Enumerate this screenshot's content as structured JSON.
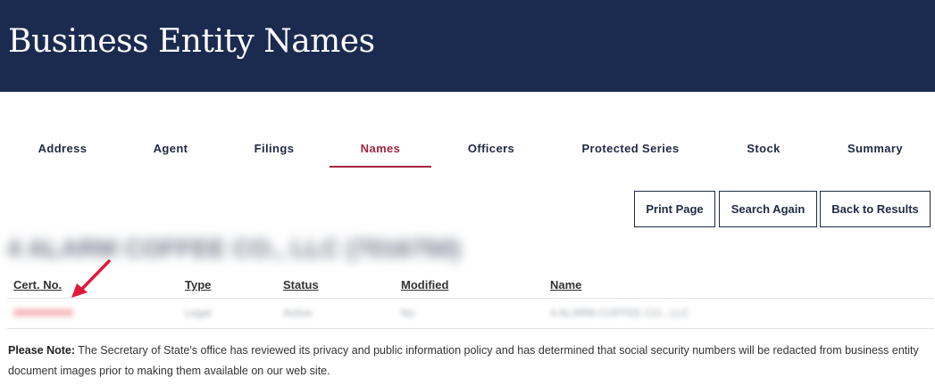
{
  "header": {
    "title": "Business Entity Names"
  },
  "tabs": [
    {
      "label": "Address",
      "active": false
    },
    {
      "label": "Agent",
      "active": false
    },
    {
      "label": "Filings",
      "active": false
    },
    {
      "label": "Names",
      "active": true
    },
    {
      "label": "Officers",
      "active": false
    },
    {
      "label": "Protected Series",
      "active": false
    },
    {
      "label": "Stock",
      "active": false
    },
    {
      "label": "Summary",
      "active": false
    }
  ],
  "actions": {
    "print_label": "Print Page",
    "search_again_label": "Search Again",
    "back_label": "Back to Results"
  },
  "entity": {
    "title": "4 ALARM COFFEE CO., LLC (7016750)"
  },
  "table": {
    "headers": [
      "Cert. No.",
      "Type",
      "Status",
      "Modified",
      "Name"
    ],
    "rows": [
      [
        "0000000000",
        "Legal",
        "Active",
        "No",
        "4 ALARM COFFEE CO., LLC"
      ]
    ]
  },
  "note": {
    "prefix": "Please Note:",
    "text": " The Secretary of State's office has reviewed its privacy and public information policy and has determined that social security numbers will be redacted from business entity document images prior to making them available on our web site."
  },
  "colors": {
    "header_bg": "#1b2b50",
    "active_tab": "#a3263f",
    "annotation_arrow": "#e0193a"
  }
}
